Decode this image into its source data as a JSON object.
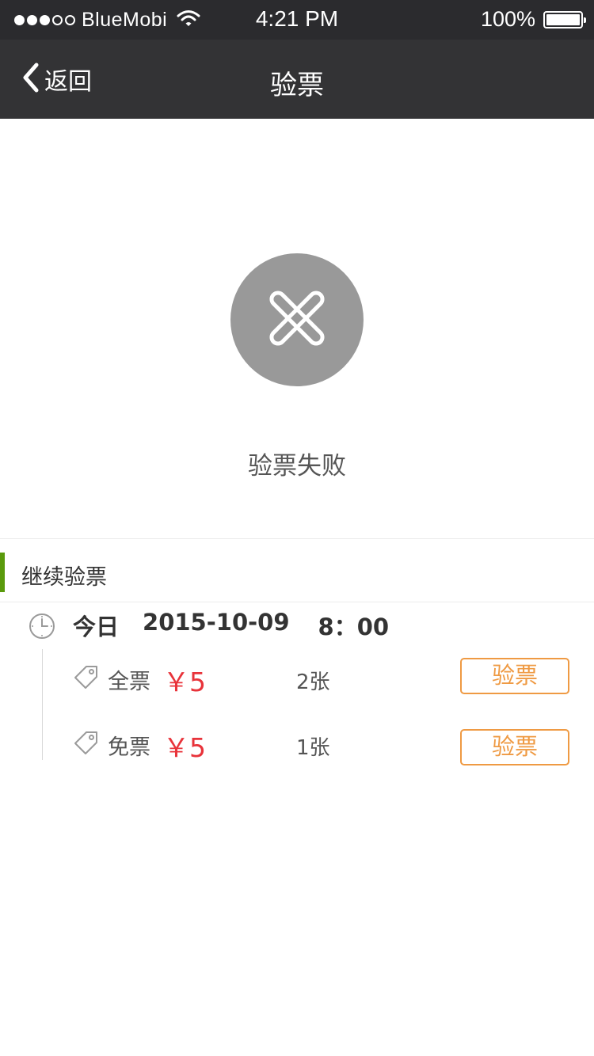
{
  "status_bar": {
    "carrier": "BlueMobi",
    "time": "4:21 PM",
    "battery": "100%",
    "signal_bars_filled": 3,
    "signal_bars_total": 5
  },
  "nav": {
    "back_label": "返回",
    "title": "验票"
  },
  "result": {
    "message": "验票失败",
    "icon": "close-icon"
  },
  "section": {
    "title": "继续验票"
  },
  "session": {
    "day": "今日",
    "date": "2015-10-09",
    "time": "8：00"
  },
  "tickets": [
    {
      "type": "全票",
      "price": "￥5",
      "count": "2张",
      "action": "验票"
    },
    {
      "type": "免票",
      "price": "￥5",
      "count": "1张",
      "action": "验票"
    }
  ],
  "colors": {
    "accent_green": "#5a9a0c",
    "price_red": "#e8333a",
    "button_orange": "#ef9a43",
    "nav_bg": "#333335"
  }
}
